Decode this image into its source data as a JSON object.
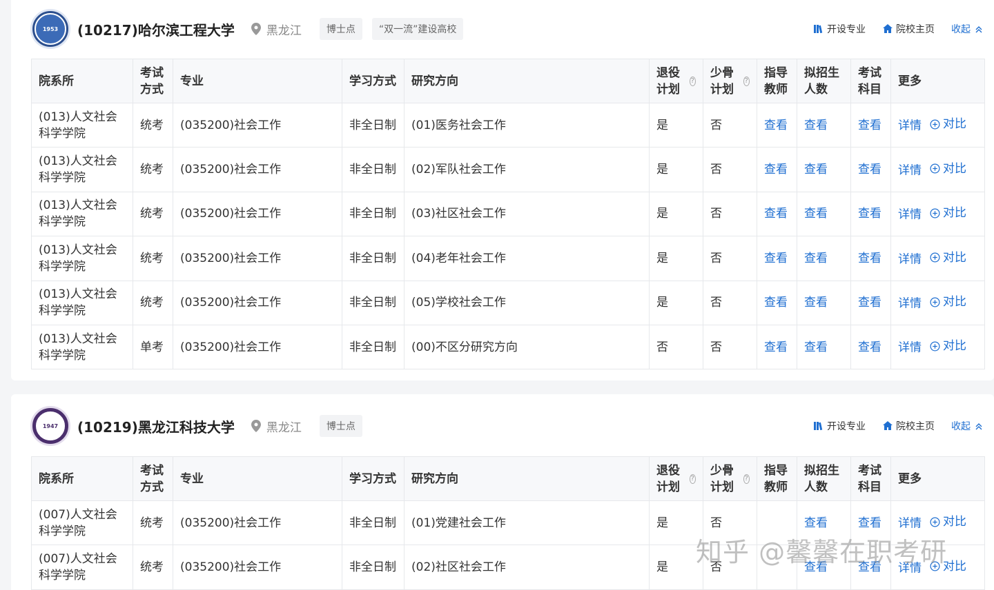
{
  "schools": [
    {
      "name": "(10217)哈尔滨工程大学",
      "location": "黑龙江",
      "tags": [
        "博士点",
        "“双一流”建设高校"
      ],
      "actions": {
        "majors": "开设专业",
        "homepage": "院校主页",
        "collapse": "收起"
      },
      "logo_text": "1953",
      "columns": [
        "院系所",
        "考试方式",
        "专业",
        "学习方式",
        "研究方向",
        "退役计划",
        "少骨计划",
        "指导教师",
        "拟招生人数",
        "考试科目",
        "更多"
      ],
      "rows": [
        {
          "dept": "(013)人文社会科学学院",
          "exam": "统考",
          "major": "(035200)社会工作",
          "mode": "非全日制",
          "direction": "(01)医务社会工作",
          "veteran": "是",
          "minority": "否",
          "advisor": "查看",
          "quota": "查看",
          "subjects": "查看",
          "detail": "详情",
          "compare": "对比"
        },
        {
          "dept": "(013)人文社会科学学院",
          "exam": "统考",
          "major": "(035200)社会工作",
          "mode": "非全日制",
          "direction": "(02)军队社会工作",
          "veteran": "是",
          "minority": "否",
          "advisor": "查看",
          "quota": "查看",
          "subjects": "查看",
          "detail": "详情",
          "compare": "对比"
        },
        {
          "dept": "(013)人文社会科学学院",
          "exam": "统考",
          "major": "(035200)社会工作",
          "mode": "非全日制",
          "direction": "(03)社区社会工作",
          "veteran": "是",
          "minority": "否",
          "advisor": "查看",
          "quota": "查看",
          "subjects": "查看",
          "detail": "详情",
          "compare": "对比"
        },
        {
          "dept": "(013)人文社会科学学院",
          "exam": "统考",
          "major": "(035200)社会工作",
          "mode": "非全日制",
          "direction": "(04)老年社会工作",
          "veteran": "是",
          "minority": "否",
          "advisor": "查看",
          "quota": "查看",
          "subjects": "查看",
          "detail": "详情",
          "compare": "对比"
        },
        {
          "dept": "(013)人文社会科学学院",
          "exam": "统考",
          "major": "(035200)社会工作",
          "mode": "非全日制",
          "direction": "(05)学校社会工作",
          "veteran": "是",
          "minority": "否",
          "advisor": "查看",
          "quota": "查看",
          "subjects": "查看",
          "detail": "详情",
          "compare": "对比"
        },
        {
          "dept": "(013)人文社会科学学院",
          "exam": "单考",
          "major": "(035200)社会工作",
          "mode": "非全日制",
          "direction": "(00)不区分研究方向",
          "veteran": "否",
          "minority": "否",
          "advisor": "查看",
          "quota": "查看",
          "subjects": "查看",
          "detail": "详情",
          "compare": "对比"
        }
      ]
    },
    {
      "name": "(10219)黑龙江科技大学",
      "location": "黑龙江",
      "tags": [
        "博士点"
      ],
      "actions": {
        "majors": "开设专业",
        "homepage": "院校主页",
        "collapse": "收起"
      },
      "logo_text": "1947",
      "columns": [
        "院系所",
        "考试方式",
        "专业",
        "学习方式",
        "研究方向",
        "退役计划",
        "少骨计划",
        "指导教师",
        "拟招生人数",
        "考试科目",
        "更多"
      ],
      "rows": [
        {
          "dept": "(007)人文社会科学学院",
          "exam": "统考",
          "major": "(035200)社会工作",
          "mode": "非全日制",
          "direction": "(01)党建社会工作",
          "veteran": "是",
          "minority": "否",
          "advisor": "",
          "quota": "查看",
          "subjects": "查看",
          "detail": "详情",
          "compare": "对比"
        },
        {
          "dept": "(007)人文社会科学学院",
          "exam": "统考",
          "major": "(035200)社会工作",
          "mode": "非全日制",
          "direction": "(02)社区社会工作",
          "veteran": "是",
          "minority": "否",
          "advisor": "",
          "quota": "查看",
          "subjects": "查看",
          "detail": "详情",
          "compare": "对比"
        }
      ]
    }
  ],
  "watermark": "知乎 @馨馨在职考研",
  "colors": {
    "link": "#1f6fd1",
    "header_bg": "#f7f8fa",
    "page_bg": "#f4f5f7"
  }
}
